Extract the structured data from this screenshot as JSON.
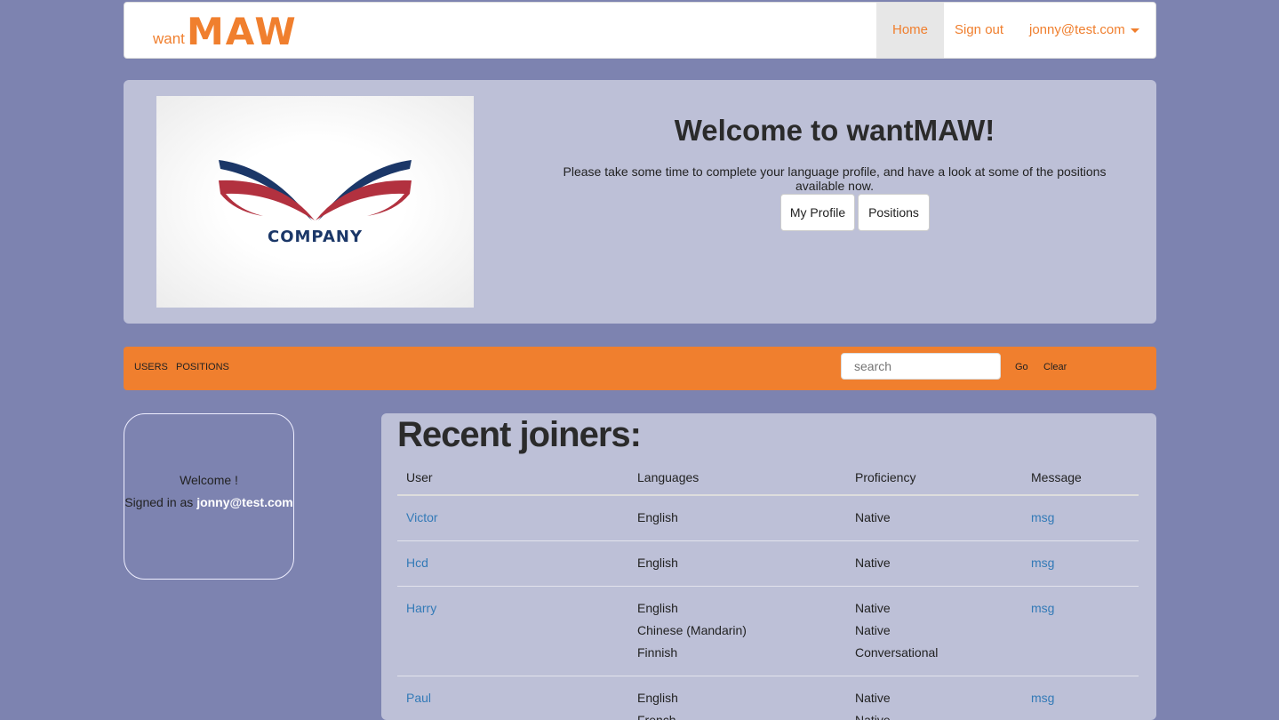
{
  "navbar": {
    "brand_want": "want",
    "brand_maw": "MAW",
    "home": "Home",
    "signout": "Sign out",
    "user": "jonny@test.com"
  },
  "hero": {
    "logo_text": "COMPANY",
    "title": "Welcome to wantMAW!",
    "subtitle": "Please take some time to complete your language profile, and have a look at some of the positions available now.",
    "btn_profile": "My Profile",
    "btn_positions": "Positions"
  },
  "subnav": {
    "users": "USERS",
    "positions": "POSITIONS",
    "search_placeholder": "search",
    "go": "Go",
    "clear": "Clear"
  },
  "welcome": {
    "line1": "Welcome !",
    "signed_prefix": "Signed in as",
    "email": "jonny@test.com"
  },
  "joiners": {
    "title": "Recent joiners:",
    "headers": [
      "User",
      "Languages",
      "Proficiency",
      "Message"
    ],
    "rows": [
      {
        "user": "Victor",
        "languages": [
          "English"
        ],
        "proficiency": [
          "Native"
        ],
        "message": "msg"
      },
      {
        "user": "Hcd",
        "languages": [
          "English"
        ],
        "proficiency": [
          "Native"
        ],
        "message": "msg"
      },
      {
        "user": "Harry",
        "languages": [
          "English",
          "Chinese (Mandarin)",
          "Finnish"
        ],
        "proficiency": [
          "Native",
          "Native",
          "Conversational"
        ],
        "message": "msg"
      },
      {
        "user": "Paul",
        "languages": [
          "English",
          "French"
        ],
        "proficiency": [
          "Native",
          "Native"
        ],
        "message": "msg"
      }
    ]
  },
  "colors": {
    "background": "#7d83b0",
    "accent": "#f07f2e",
    "panel": "#bdc0d7",
    "link": "#337ab7"
  }
}
